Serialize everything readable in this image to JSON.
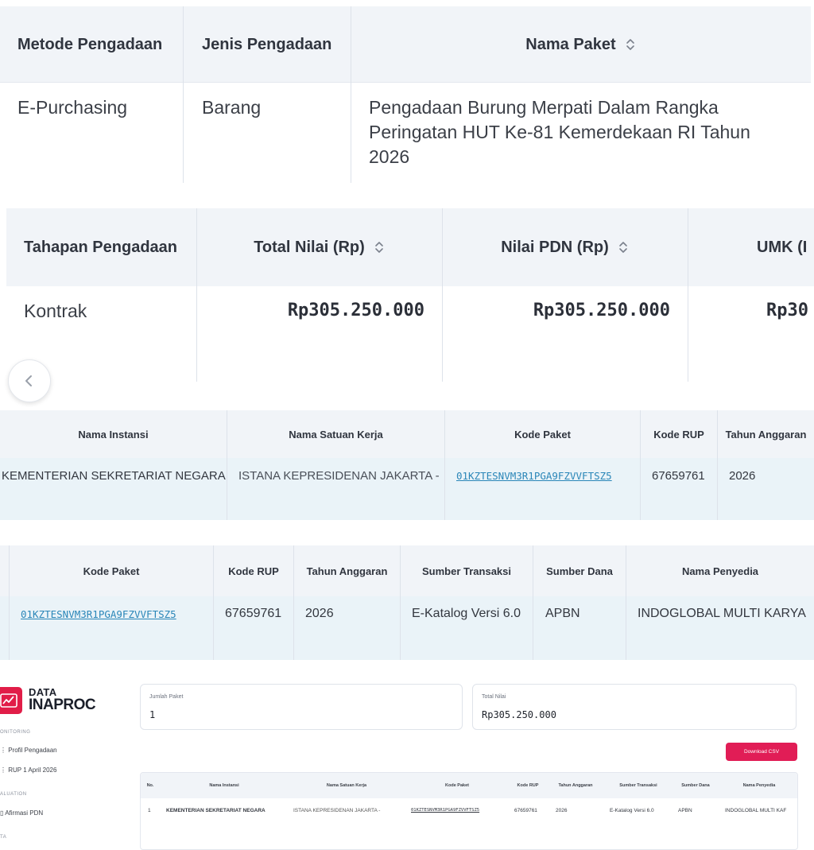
{
  "table_procurement": {
    "headers": [
      "Metode Pengadaan",
      "Jenis Pengadaan",
      "Nama Paket"
    ],
    "row": {
      "metode": "E-Purchasing",
      "jenis": "Barang",
      "nama_paket_lines": [
        "Pengadaan Burung Merpati Dalam Rangka",
        "Peringatan HUT Ke-81 Kemerdekaan RI Tahun",
        "2026"
      ]
    }
  },
  "table_values": {
    "headers": [
      "Tahapan Pengadaan",
      "Total Nilai (Rp)",
      "Nilai PDN (Rp)",
      "UMK (I"
    ],
    "row": {
      "tahapan": "Kontrak",
      "total_nilai": "Rp305.250.000",
      "nilai_pdn": "Rp305.250.000",
      "umk": "Rp30"
    }
  },
  "table_instansi": {
    "headers": [
      "Nama Instansi",
      "Nama Satuan Kerja",
      "Kode Paket",
      "Kode RUP",
      "Tahun Anggaran"
    ],
    "row": {
      "instansi": "KEMENTERIAN SEKRETARIAT NEGARA",
      "satuan_kerja": "ISTANA KEPRESIDENAN JAKARTA -",
      "kode_paket": "01KZTESNVM3R1PGA9FZVVFTSZ5",
      "kode_rup": "67659761",
      "tahun": "2026"
    }
  },
  "table_penyedia": {
    "headers": [
      "Kode Paket",
      "Kode RUP",
      "Tahun Anggaran",
      "Sumber Transaksi",
      "Sumber Dana",
      "Nama Penyedia"
    ],
    "row": {
      "kode_paket": "01KZTESNVM3R1PGA9FZVVFTSZ5",
      "kode_rup": "67659761",
      "tahun": "2026",
      "sumber_transaksi": "E-Katalog Versi 6.0",
      "sumber_dana": "APBN",
      "penyedia": "INDOGLOBAL MULTI KARYA"
    }
  },
  "dashboard": {
    "logo_top": "DATA",
    "logo_bottom": "INAPROC",
    "sidebar": {
      "section_monitoring": "ONITORING",
      "item_profil": "Profil Pengadaan",
      "item_rup": "RUP 1 April 2026",
      "section_evaluation": "ALUATION",
      "item_afirmasi": "Afirmasi PDN",
      "section_data": "TA"
    },
    "jumlah_paket_label": "Jumlah Paket",
    "jumlah_paket_value": "1",
    "total_nilai_label": "Total Nilai",
    "total_nilai_value": "Rp305.250.000",
    "download_label": "Download CSV",
    "table_headers": [
      "No.",
      "Nama Instansi",
      "Nama Satuan Kerja",
      "Kode Paket",
      "Kode RUP",
      "Tahun Anggaran",
      "Sumber Transaksi",
      "Sumber Dana",
      "Nama Penyedia"
    ],
    "table_row": [
      "1",
      "KEMENTERIAN SEKRETARIAT NEGARA",
      "ISTANA KEPRESIDENAN JAKARTA -",
      "01KZTESNVM3R1PGA9FZVVFTSZ5",
      "67659761",
      "2026",
      "E-Katalog Versi 6.0",
      "APBN",
      "INDOGLOBAL MULTI KAF"
    ]
  },
  "colors": {
    "header_bg": "#f1f4f8",
    "row_highlight": "#eaf3f8",
    "link": "#2a86b8",
    "brand_red": "#e11d48"
  }
}
